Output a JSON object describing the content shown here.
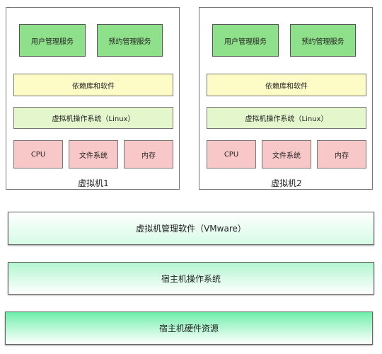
{
  "vms": [
    {
      "label": "虚拟机1",
      "services": [
        "用户管理服务",
        "预约管理服务"
      ],
      "deps": "依赖库和软件",
      "os": "虚拟机操作系统（Linux）",
      "resources": [
        "CPU",
        "文件系统",
        "内存"
      ]
    },
    {
      "label": "虚拟机2",
      "services": [
        "用户管理服务",
        "预约管理服务"
      ],
      "deps": "依赖库和软件",
      "os": "虚拟机操作系统（Linux）",
      "resources": [
        "CPU",
        "文件系统",
        "内存"
      ]
    }
  ],
  "layers": [
    "虚拟机管理软件（VMware）",
    "宿主机操作系统",
    "宿主机硬件资源"
  ]
}
